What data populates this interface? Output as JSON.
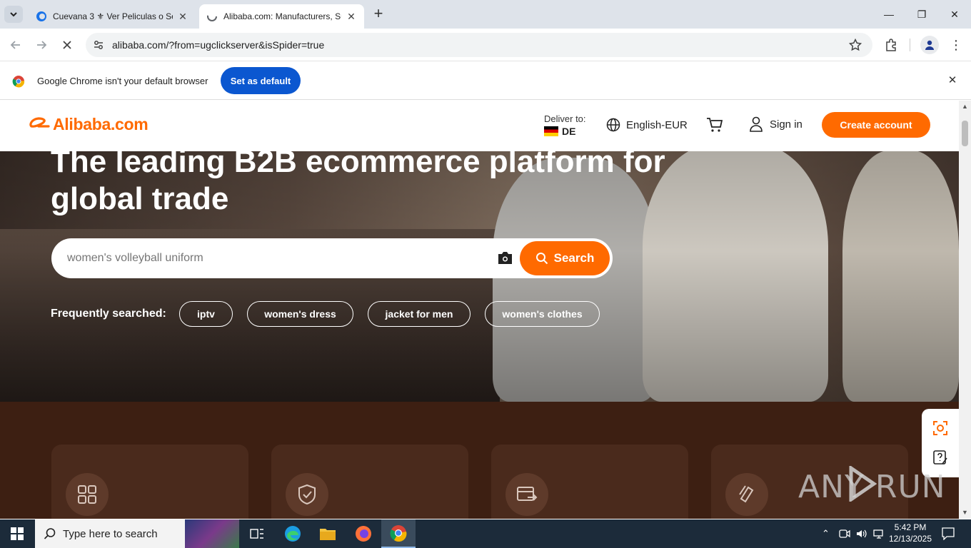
{
  "browser": {
    "tabs": [
      {
        "title": "Cuevana 3 ⚜ Ver Peliculas o Se",
        "active": false
      },
      {
        "title": "Alibaba.com: Manufacturers, Su",
        "active": true
      }
    ],
    "url": "alibaba.com/?from=ugclickserver&isSpider=true",
    "infobar": {
      "message": "Google Chrome isn't your default browser",
      "button": "Set as default"
    }
  },
  "site": {
    "logo": "Alibaba.com",
    "deliver_label": "Deliver to:",
    "deliver_country": "DE",
    "language": "English-EUR",
    "sign_in": "Sign in",
    "create_account": "Create account",
    "headline": "The leading B2B ecommerce platform for global trade",
    "search_placeholder": "women's volleyball uniform",
    "search_button": "Search",
    "frequently_label": "Frequently searched:",
    "chips": [
      "iptv",
      "women's dress",
      "jacket for men",
      "women's clothes"
    ]
  },
  "watermark": "ANY RUN",
  "taskbar": {
    "search_placeholder": "Type here to search",
    "time": "5:42 PM",
    "date": "12/13/2025"
  },
  "colors": {
    "accent": "#ff6a00",
    "chrome_blue": "#0b57d0",
    "taskbar": "#1c2b3a"
  }
}
